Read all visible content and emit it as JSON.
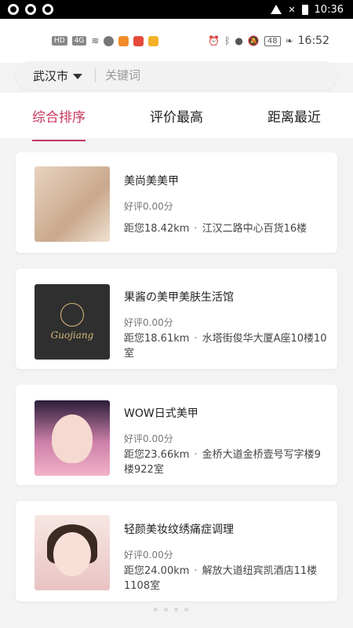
{
  "system": {
    "time": "10:36"
  },
  "app_status": {
    "battery": "48",
    "time": "16:52"
  },
  "search": {
    "city": "武汉市",
    "placeholder": "关键词"
  },
  "tabs": [
    {
      "label": "综合排序"
    },
    {
      "label": "评价最高"
    },
    {
      "label": "距离最近"
    }
  ],
  "shops": [
    {
      "name": "美尚美美甲",
      "rating": "好评0.00分",
      "distance": "距您18.42km",
      "address": "江汉二路中心百货16楼"
    },
    {
      "name": "果酱の美甲美肤生活馆",
      "rating": "好评0.00分",
      "distance": "距您18.61km",
      "address": "水塔街俊华大厦A座10楼10室",
      "logo_text": "Guojiang"
    },
    {
      "name": "WOW日式美甲",
      "rating": "好评0.00分",
      "distance": "距您23.66km",
      "address": "金桥大道金桥壹号写字楼9楼922室"
    },
    {
      "name": "轻颜美妆纹绣痛症调理",
      "rating": "好评0.00分",
      "distance": "距您24.00km",
      "address": "解放大道纽宾凯酒店11楼1108室"
    }
  ]
}
